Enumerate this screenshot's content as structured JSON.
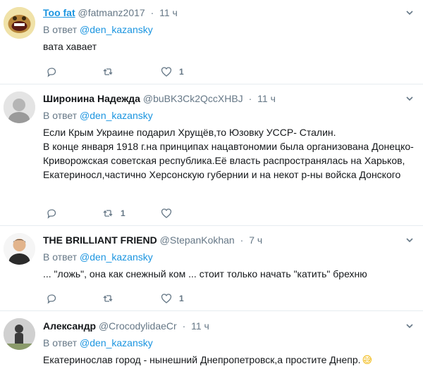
{
  "tweets": [
    {
      "name": "Too fat",
      "handle": "@fatmanz2017",
      "time": "11 ч",
      "reply_prefix": "В ответ",
      "reply_mention": "@den_kazansky",
      "text": "вата хавает",
      "reply_count": "",
      "retweet_count": "",
      "like_count": "1"
    },
    {
      "name": "Широнина Надежда",
      "handle": "@buBK3Ck2QccXHBJ",
      "time": "11 ч",
      "reply_prefix": "В ответ",
      "reply_mention": "@den_kazansky",
      "text": "Если Крым Украине подарил Хрущёв,то Юзовку УССР- Сталин.\nВ конце января 1918 г.на принципах нацавтономии была организована Донецко-Криворожская советская республика.Её власть распространялась на  Харьков, Екатериносл,частично Херсонскую губернии и на некот р-ны войска Донского",
      "reply_count": "",
      "retweet_count": "1",
      "like_count": ""
    },
    {
      "name": "THE BRILLIANT FRIEND",
      "handle": "@StepanKokhan",
      "time": "7 ч",
      "reply_prefix": "В ответ",
      "reply_mention": "@den_kazansky",
      "text": "... \"ложь\", она как снежный ком ... стоит только начать \"катить\" брехню",
      "reply_count": "",
      "retweet_count": "",
      "like_count": "1"
    },
    {
      "name": "Александр",
      "handle": "@CrocodylidaeCr",
      "time": "11 ч",
      "reply_prefix": "В ответ",
      "reply_mention": "@den_kazansky",
      "text": "Екатеринослав город - нынешний Днепропетровск,а простите Днепр.",
      "emoji": "😅"
    }
  ]
}
